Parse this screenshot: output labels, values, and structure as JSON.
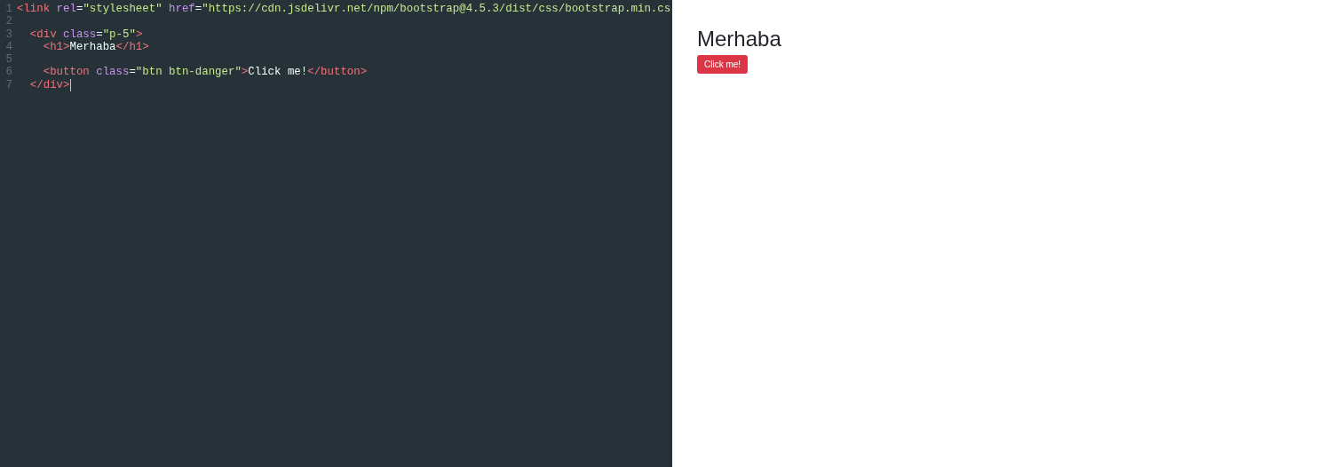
{
  "editor": {
    "lines": [
      {
        "number": "1",
        "tokens": [
          {
            "kind": "tag",
            "text": "<link"
          },
          {
            "kind": "attr",
            "text": " rel"
          },
          {
            "kind": "text",
            "text": "="
          },
          {
            "kind": "string",
            "text": "\"stylesheet\""
          },
          {
            "kind": "attr",
            "text": " href"
          },
          {
            "kind": "text",
            "text": "="
          },
          {
            "kind": "string",
            "text": "\"https://cdn.jsdelivr.net/npm/bootstrap@4.5.3/dist/css/bootstrap.min.cs"
          }
        ]
      },
      {
        "number": "2"
      },
      {
        "number": "3",
        "tokens": [
          {
            "kind": "tag",
            "text": "  <div"
          },
          {
            "kind": "attr",
            "text": " class"
          },
          {
            "kind": "text",
            "text": "="
          },
          {
            "kind": "string",
            "text": "\"p-5\""
          },
          {
            "kind": "tag",
            "text": ">"
          }
        ]
      },
      {
        "number": "4",
        "tokens": [
          {
            "kind": "tag",
            "text": "    <h1>"
          },
          {
            "kind": "text",
            "text": "Merhaba"
          },
          {
            "kind": "tag",
            "text": "</h1>"
          }
        ]
      },
      {
        "number": "5"
      },
      {
        "number": "6",
        "tokens": [
          {
            "kind": "tag",
            "text": "    <button"
          },
          {
            "kind": "attr",
            "text": " class"
          },
          {
            "kind": "text",
            "text": "="
          },
          {
            "kind": "string",
            "text": "\"btn btn-danger\""
          },
          {
            "kind": "tag",
            "text": ">"
          },
          {
            "kind": "text",
            "text": "Click me!"
          },
          {
            "kind": "tag",
            "text": "</button>"
          }
        ]
      },
      {
        "number": "7",
        "tokens": [
          {
            "kind": "tag",
            "text": "  </div>"
          }
        ]
      }
    ]
  },
  "preview": {
    "heading": "Merhaba",
    "button": "Click me!"
  }
}
